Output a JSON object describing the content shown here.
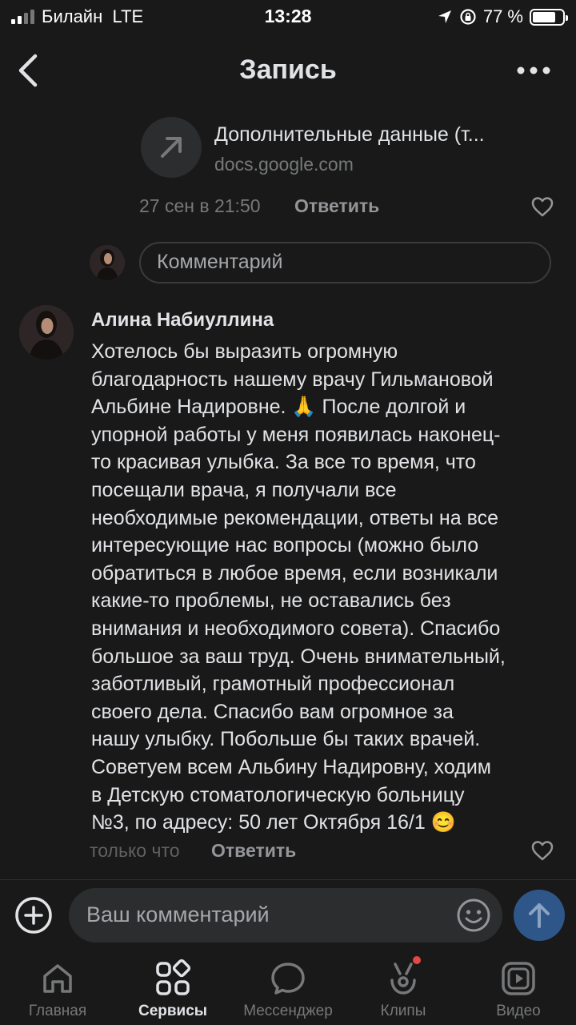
{
  "status_bar": {
    "carrier": "Билайн",
    "network": "LTE",
    "time": "13:28",
    "battery": "77 %",
    "battery_level": 0.77
  },
  "header": {
    "title": "Запись",
    "back_icon": "chevron-left-icon",
    "more_icon": "more-horizontal-icon"
  },
  "post": {
    "link": {
      "title": "Дополнительные данные (т...",
      "host": "docs.google.com",
      "icon": "external-link-arrow-icon"
    },
    "timestamp": "27 сен в 21:50",
    "reply_label": "Ответить",
    "comment_placeholder": "Комментарий"
  },
  "comment": {
    "author": "Алина Набиуллина",
    "lines": [
      "Хотелось бы выразить огромную",
      "благодарность нашему врачу Гильмановой",
      "Альбине Надировне. 🙏 После долгой и",
      "упорной работы у меня появилась наконец-",
      "то красивая улыбка. За все то время, что",
      "посещали врача, я получали все",
      "необходимые рекомендации, ответы на все",
      "интересующие нас вопросы (можно было",
      "обратиться в любое время, если возникали",
      "какие-то проблемы, не оставались без",
      "внимания и необходимого совета). Спасибо",
      "большое за ваш труд.  Очень внимательный,",
      "заботливый, грамотный профессионал",
      "своего дела. Спасибо вам огромное за",
      "нашу улыбку. Побольше бы таких врачей.",
      "Советуем всем Альбину Надировну, ходим",
      "в Детскую стоматологическую больницу",
      "№3, по адресу: 50 лет Октября 16/1 😊"
    ],
    "timestamp": "только что",
    "reply_label": "Ответить"
  },
  "compose": {
    "placeholder": "Ваш комментарий"
  },
  "tabs": [
    {
      "label": "Главная",
      "icon": "home-icon",
      "active": false
    },
    {
      "label": "Сервисы",
      "icon": "services-grid-icon",
      "active": true
    },
    {
      "label": "Мессенджер",
      "icon": "messenger-icon",
      "active": false
    },
    {
      "label": "Клипы",
      "icon": "clips-icon",
      "active": false,
      "badge": true
    },
    {
      "label": "Видео",
      "icon": "video-icon",
      "active": false
    }
  ],
  "colors": {
    "background": "#191919",
    "text": "#e1e3e6",
    "secondary": "#76787a",
    "send_button": "#2f5688",
    "badge": "#e64646"
  }
}
